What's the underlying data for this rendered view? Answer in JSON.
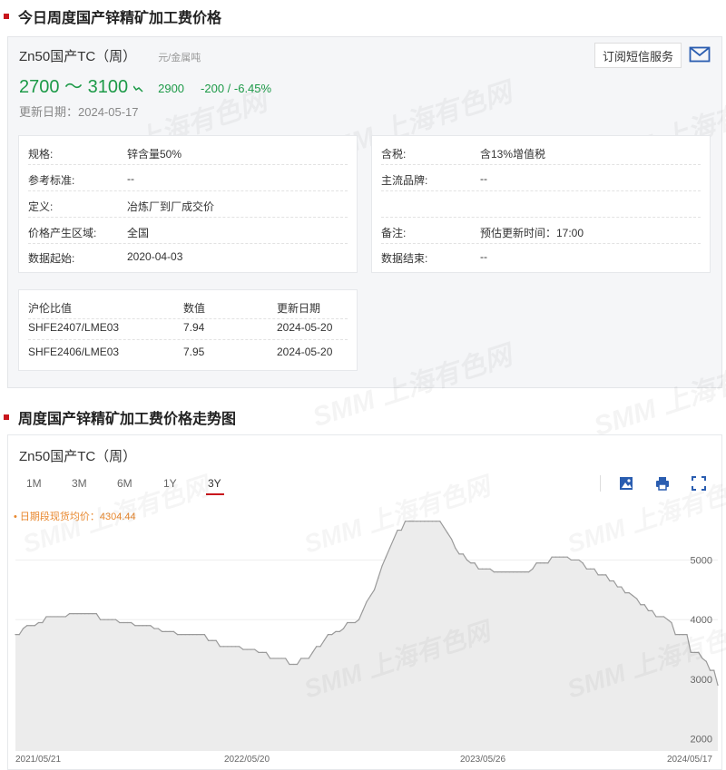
{
  "section1": {
    "title": "今日周度国产锌精矿加工费价格"
  },
  "product": {
    "name": "Zn50国产TC（周）",
    "unit": "元/金属吨",
    "subscribe_label": "订阅短信服务",
    "price_range": "2700 ～ 3100",
    "trend_icon": "down-trend-icon",
    "average": "2900",
    "change": "-200  /  -6.45%",
    "update_date": "更新日期：2024-05-17",
    "price_color": "#1d9a48"
  },
  "specs_left": [
    {
      "label": "规格:",
      "value": "锌含量50%"
    },
    {
      "label": "参考标准:",
      "value": "--"
    },
    {
      "label": "定义:",
      "value": "冶炼厂到厂成交价"
    },
    {
      "label": "价格产生区域:",
      "value": "全国"
    },
    {
      "label": "数据起始:",
      "value": "2020-04-03"
    }
  ],
  "specs_right": [
    {
      "label": "含税:",
      "value": "含13%增值税"
    },
    {
      "label": "主流品牌:",
      "value": "--"
    },
    {
      "label": "备注:",
      "value": "预估更新时间：17:00"
    },
    {
      "label": "数据结束:",
      "value": "--"
    }
  ],
  "ratio_table": {
    "headers": [
      "沪伦比值",
      "数值",
      "更新日期"
    ],
    "rows": [
      [
        "SHFE2407/LME03",
        "7.94",
        "2024-05-20"
      ],
      [
        "SHFE2406/LME03",
        "7.95",
        "2024-05-20"
      ]
    ]
  },
  "section2": {
    "title": "周度国产锌精矿加工费价格走势图"
  },
  "chart_panel": {
    "title": "Zn50国产TC（周）",
    "ranges": [
      "1M",
      "3M",
      "6M",
      "1Y",
      "3Y"
    ],
    "active_range": "3Y",
    "tools": [
      "image-download-icon",
      "print-icon",
      "fullscreen-icon"
    ],
    "avg_label": "• 日期段现货均价：4304.44"
  },
  "watermark": "SMM 上海有色网",
  "accent_color": "#c8161d",
  "chart_data": {
    "type": "area",
    "x_start": "2021/05/21",
    "x_end": "2024/05/17",
    "x_ticks": [
      "2021/05/21",
      "2022/05/20",
      "2023/05/26",
      "2024/05/17"
    ],
    "y_ticks": [
      "2000",
      "3000",
      "4000",
      "5000"
    ],
    "ylim": [
      1950,
      5600
    ],
    "y_axis_position": "right",
    "average": 4304.44,
    "series": [
      {
        "values": [
          3750,
          3750,
          3850,
          3900,
          3900,
          3900,
          3950,
          3950,
          4050,
          4050,
          4050,
          4050,
          4050,
          4050,
          4100,
          4100,
          4100,
          4100,
          4100,
          4100,
          4100,
          4100,
          4000,
          4000,
          4000,
          4000,
          4000,
          3950,
          3950,
          3950,
          3950,
          3900,
          3900,
          3900,
          3900,
          3900,
          3850,
          3850,
          3800,
          3800,
          3800,
          3800,
          3750,
          3750,
          3750,
          3750,
          3750,
          3750,
          3750,
          3750,
          3650,
          3650,
          3650,
          3550,
          3550,
          3550,
          3550,
          3550,
          3550,
          3500,
          3500,
          3500,
          3500,
          3450,
          3450,
          3450,
          3350,
          3350,
          3350,
          3350,
          3350,
          3250,
          3250,
          3250,
          3350,
          3350,
          3350,
          3450,
          3550,
          3550,
          3650,
          3750,
          3750,
          3800,
          3800,
          3850,
          3950,
          3950,
          3950,
          4000,
          4150,
          4300,
          4400,
          4500,
          4700,
          4900,
          5050,
          5200,
          5350,
          5500,
          5500,
          5650,
          5650,
          5650,
          5650,
          5650,
          5650,
          5650,
          5650,
          5650,
          5650,
          5550,
          5450,
          5350,
          5200,
          5100,
          5100,
          5000,
          4950,
          4950,
          4850,
          4850,
          4850,
          4850,
          4800,
          4800,
          4800,
          4800,
          4800,
          4800,
          4800,
          4800,
          4800,
          4800,
          4850,
          4950,
          4950,
          4950,
          4950,
          5050,
          5050,
          5050,
          5050,
          5050,
          5000,
          5000,
          5000,
          4950,
          4850,
          4850,
          4850,
          4750,
          4750,
          4750,
          4650,
          4650,
          4550,
          4550,
          4450,
          4450,
          4400,
          4350,
          4250,
          4250,
          4150,
          4150,
          4050,
          4050,
          4050,
          4000,
          3950,
          3750,
          3750,
          3750,
          3750,
          3450,
          3450,
          3450,
          3350,
          3300,
          3150,
          3150,
          2900
        ]
      }
    ]
  }
}
